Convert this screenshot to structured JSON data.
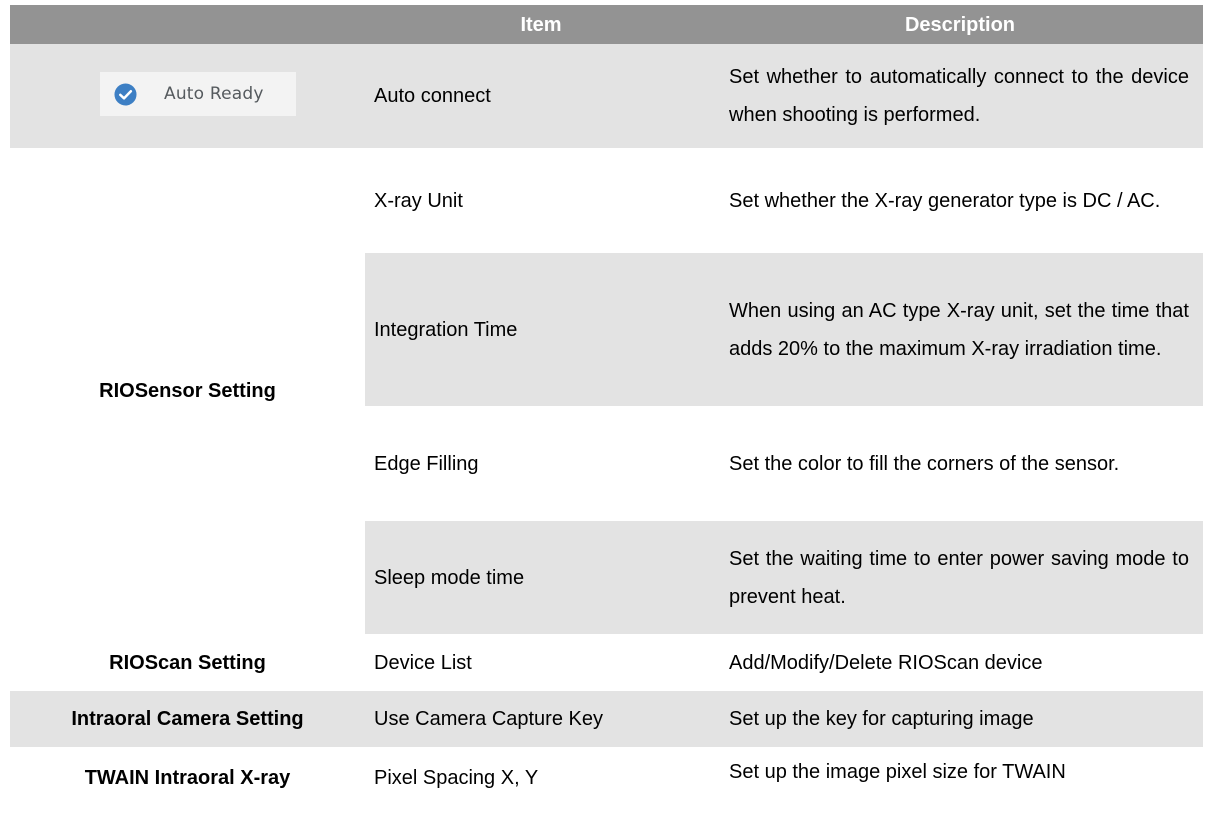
{
  "header": {
    "col1": "",
    "col2": "Item",
    "col3": "Description"
  },
  "auto_ready": {
    "label": "Auto Ready",
    "icon": "check-circle-icon",
    "accent": "#3d7fc4",
    "item": "Auto connect",
    "description": "Set whether to automatically connect to the device when shooting is performed."
  },
  "riosensor": {
    "label": "RIOSensor Setting",
    "rows": [
      {
        "item": "X-ray Unit",
        "description": "Set whether the X-ray generator type is DC / AC."
      },
      {
        "item": "Integration Time",
        "description": "When using an AC type X-ray unit, set the time that adds 20% to the maximum X-ray irradiation time."
      },
      {
        "item": "Edge Filling",
        "description": "Set the color to fill the corners of the sensor."
      },
      {
        "item": "Sleep mode time",
        "description": "Set the waiting time to enter power saving mode to prevent heat."
      }
    ]
  },
  "rioscan": {
    "label": "RIOScan Setting",
    "item": "Device List",
    "description": "Add/Modify/Delete RIOScan device"
  },
  "camera": {
    "label": "Intraoral Camera Setting",
    "item": "Use Camera Capture Key",
    "description": "Set up the key for capturing image"
  },
  "twain": {
    "label": "TWAIN Intraoral X-ray",
    "item": "Pixel Spacing X, Y",
    "description": "Set up the image pixel size for TWAIN"
  },
  "colors": {
    "header_bg": "#939393",
    "shade_bg": "#e3e3e3",
    "header_text": "#ffffff"
  }
}
